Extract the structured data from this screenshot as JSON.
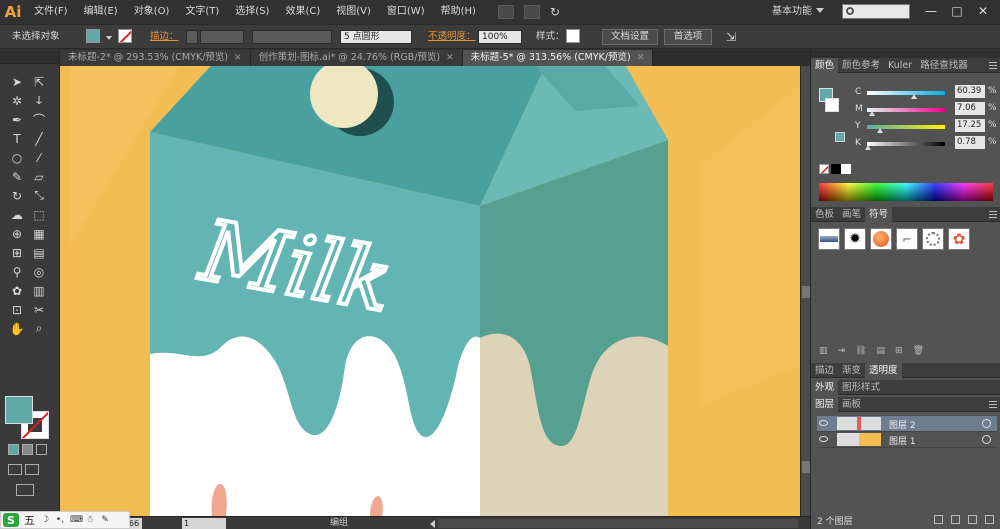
{
  "app": {
    "logo": "Ai",
    "workspace": "基本功能"
  },
  "menu": [
    "文件(F)",
    "编辑(E)",
    "对象(O)",
    "文字(T)",
    "选择(S)",
    "效果(C)",
    "视图(V)",
    "窗口(W)",
    "帮助(H)"
  ],
  "window_buttons": [
    "—",
    "□",
    "✕"
  ],
  "control_bar": {
    "selection": "未选择对象",
    "fill_color": "#5fa9a8",
    "stroke_label": "描边：",
    "brush": "5 点圆形",
    "opacity_label": "不透明度：",
    "opacity_value": "100%",
    "style_label": "样式：",
    "doc_settings": "文档设置",
    "preferences": "首选项"
  },
  "tabs": [
    {
      "label": "未标题-2* @ 293.53% (CMYK/预览)",
      "active": false
    },
    {
      "label": "创作策划-图标.ai* @ 24.76% (RGB/预览)",
      "active": false
    },
    {
      "label": "未标题-5* @ 313.56% (CMYK/预览)",
      "active": true
    }
  ],
  "artwork": {
    "text": "Milk",
    "colors": {
      "background": "#f2bd52",
      "carton_front": "#62b5b3",
      "carton_side": "#55a090",
      "carton_top_front": "#4aa09e",
      "carton_top_side": "#6bbab6",
      "cap": "#efe6c2",
      "cap_shadow": "#1f4f4e",
      "milk": "#ffffff",
      "milk_side": "#dcd3b8",
      "accent": "#f0a890"
    }
  },
  "status_bar": {
    "zoom": "66",
    "page": "1",
    "label": "编组"
  },
  "ime": {
    "logo": "S",
    "mode": "五"
  },
  "color_panel": {
    "tabs": [
      "颜色",
      "颜色参考",
      "Kuler",
      "路径查找器"
    ],
    "channels": [
      {
        "label": "C",
        "value": "60.39",
        "fraction": 0.6,
        "gradient": "linear-gradient(to right,#fff,#00aeef)"
      },
      {
        "label": "M",
        "value": "7.06",
        "fraction": 0.07,
        "gradient": "linear-gradient(to right,#e8f6f4,#ec008c)"
      },
      {
        "label": "Y",
        "value": "17.25",
        "fraction": 0.17,
        "gradient": "linear-gradient(to right,#5fa9a8,#fff200)"
      },
      {
        "label": "K",
        "value": "0.78",
        "fraction": 0.01,
        "gradient": "linear-gradient(to right,#fff,#000)"
      }
    ],
    "unit": "%"
  },
  "symbol_panel": {
    "tabs": [
      "色板",
      "画笔",
      "符号"
    ],
    "symbols": [
      "blue-stripe",
      "ink-splat",
      "orange-ball",
      "arrow-doc",
      "dotted-circle",
      "flower"
    ]
  },
  "transparency_panel": {
    "tabs": [
      "描边",
      "渐变",
      "透明度"
    ]
  },
  "appearance_panel": {
    "tabs": [
      "外观",
      "图形样式"
    ]
  },
  "layers_panel": {
    "tabs": [
      "图层",
      "画板"
    ],
    "layers": [
      {
        "name": "图层 2",
        "selected": true
      },
      {
        "name": "图层 1",
        "selected": false
      }
    ],
    "footer": "2 个图层"
  }
}
